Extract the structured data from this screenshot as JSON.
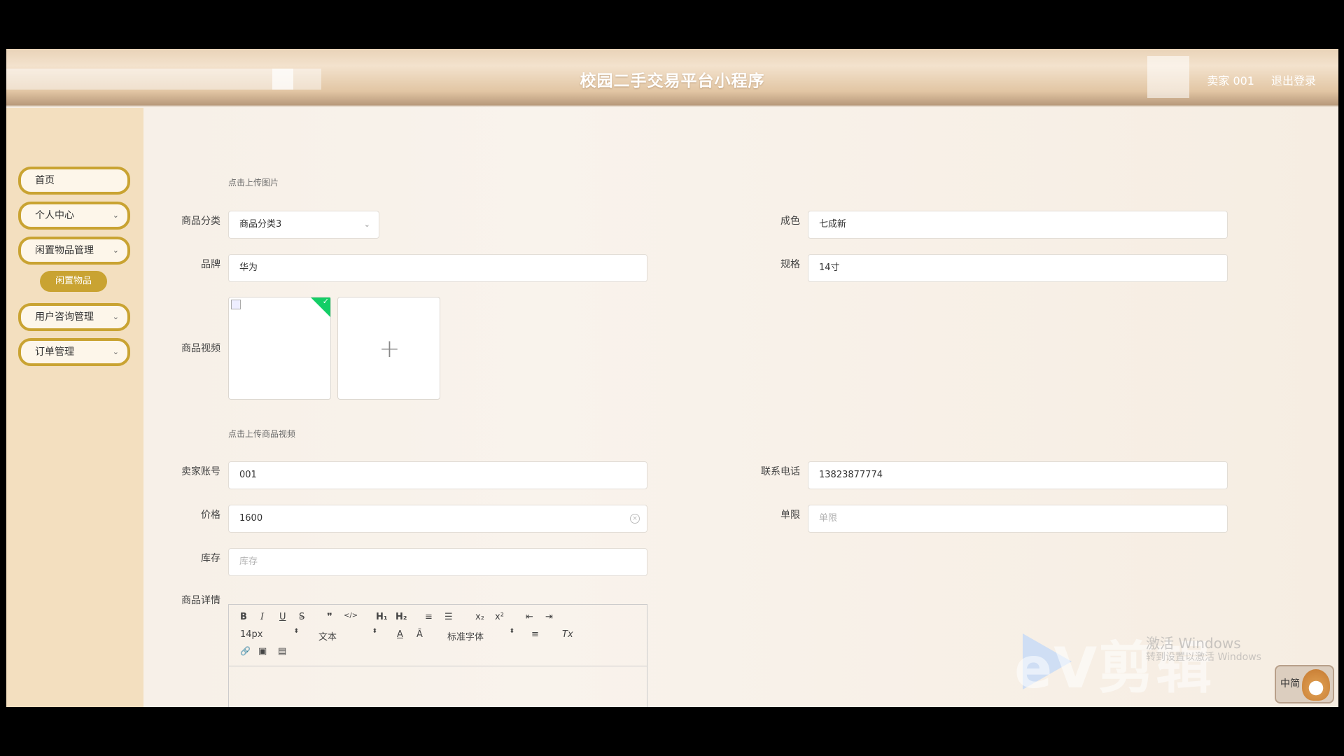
{
  "header": {
    "title": "校园二手交易平台小程序",
    "user": "卖家 001",
    "logout": "退出登录"
  },
  "sidebar": {
    "items": [
      {
        "label": "首页",
        "has_chevron": false
      },
      {
        "label": "个人中心",
        "has_chevron": true
      },
      {
        "label": "闲置物品管理",
        "has_chevron": true
      },
      {
        "label": "用户咨询管理",
        "has_chevron": true
      },
      {
        "label": "订单管理",
        "has_chevron": true
      }
    ],
    "active_sub": "闲置物品",
    "chevron": "⌄"
  },
  "form": {
    "image_hint": "点击上传图片",
    "category": {
      "label": "商品分类",
      "value": "商品分类3"
    },
    "condition": {
      "label": "成色",
      "value": "七成新"
    },
    "brand": {
      "label": "品牌",
      "value": "华为"
    },
    "spec": {
      "label": "规格",
      "value": "14寸"
    },
    "video": {
      "label": "商品视频",
      "plus": "+",
      "uploaded_check": "✓"
    },
    "video_hint": "点击上传商品视频",
    "seller_account": {
      "label": "卖家账号",
      "value": "001"
    },
    "phone": {
      "label": "联系电话",
      "value": "13823877774"
    },
    "price": {
      "label": "价格",
      "value": "1600",
      "clear": "×"
    },
    "limit": {
      "label": "单限",
      "placeholder": "单限"
    },
    "stock": {
      "label": "库存",
      "placeholder": "库存"
    },
    "detail": {
      "label": "商品详情"
    }
  },
  "editor": {
    "toolbar_row1": [
      "B",
      "I",
      "U",
      "S",
      "❞",
      "</>",
      "H₁",
      "H₂",
      "≡",
      "☰",
      "x₂",
      "x²",
      "⇤",
      "⇥"
    ],
    "size_select": "14px",
    "format_select": "文本",
    "font_select": "标准字体",
    "row2_icons": [
      "A",
      "Ā",
      "≡",
      "Tx"
    ],
    "row3_icons": [
      "🔗",
      "▣",
      "▤"
    ],
    "updown": "⬍"
  },
  "overlay": {
    "watermark": "eV剪辑",
    "windows_activation": "激活 Windows",
    "windows_activation_sub": "转到设置以激活 Windows",
    "ime": "中简"
  }
}
